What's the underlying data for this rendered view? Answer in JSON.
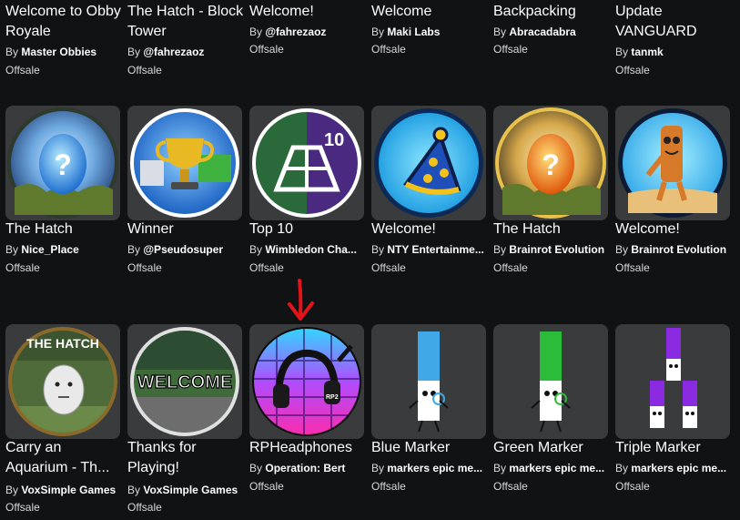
{
  "colors": {
    "background": "#111214",
    "tile": "#393b3d",
    "annotation_arrow": "#e0141a"
  },
  "rows": [
    {
      "items": [
        {
          "title": "Welcome to Obby Royale",
          "by": "By",
          "creator": "Master Obbies",
          "price": "Offsale"
        },
        {
          "title": "The Hatch - Block Tower",
          "by": "By",
          "creator": "@fahrezaoz",
          "price": "Offsale"
        },
        {
          "title": "Welcome!",
          "by": "By",
          "creator": "@fahrezaoz",
          "price": "Offsale"
        },
        {
          "title": "Welcome",
          "by": "By",
          "creator": "Maki Labs",
          "price": "Offsale"
        },
        {
          "title": "Backpacking",
          "by": "By",
          "creator": "Abracadabra",
          "price": "Offsale"
        },
        {
          "title": "Update VANGUARD",
          "by": "By",
          "creator": "tanmk",
          "price": "Offsale"
        }
      ]
    },
    {
      "items": [
        {
          "title": "The Hatch",
          "by": "By",
          "creator": "Nice_Place",
          "price": "Offsale",
          "icon": "hatch-egg-icon"
        },
        {
          "title": "Winner",
          "by": "By",
          "creator": "@Pseudosuper",
          "price": "Offsale",
          "icon": "trophy-icon"
        },
        {
          "title": "Top 10",
          "by": "By",
          "creator": "Wimbledon Cha...",
          "price": "Offsale",
          "icon": "tennis-court-icon",
          "badge_text": "10"
        },
        {
          "title": "Welcome!",
          "by": "By",
          "creator": "NTY Entertainme...",
          "price": "Offsale",
          "icon": "party-hat-icon"
        },
        {
          "title": "The Hatch",
          "by": "By",
          "creator": "Brainrot Evolution",
          "price": "Offsale",
          "icon": "fire-egg-icon"
        },
        {
          "title": "Welcome!",
          "by": "By",
          "creator": "Brainrot Evolution",
          "price": "Offsale",
          "icon": "stick-character-icon"
        }
      ]
    },
    {
      "items": [
        {
          "title": "Carry an Aquarium - Th...",
          "by": "By",
          "creator": "VoxSimple Games",
          "price": "Offsale",
          "icon": "egg-character-icon",
          "badge_text": "THE HATCH"
        },
        {
          "title": "Thanks for Playing!",
          "by": "By",
          "creator": "VoxSimple Games",
          "price": "Offsale",
          "icon": "welcome-scene-icon",
          "badge_text": "WELCOME"
        },
        {
          "title": "RPHeadphones",
          "by": "By",
          "creator": "Operation: Bert",
          "price": "Offsale",
          "icon": "headphones-icon",
          "badge_text": "RP2"
        },
        {
          "title": "Blue Marker",
          "by": "By",
          "creator": "markers epic me...",
          "price": "Offsale",
          "icon": "blue-marker-icon"
        },
        {
          "title": "Green Marker",
          "by": "By",
          "creator": "markers epic me...",
          "price": "Offsale",
          "icon": "green-marker-icon"
        },
        {
          "title": "Triple Marker",
          "by": "By",
          "creator": "markers epic me...",
          "price": "Offsale",
          "icon": "triple-marker-icon"
        }
      ]
    }
  ]
}
